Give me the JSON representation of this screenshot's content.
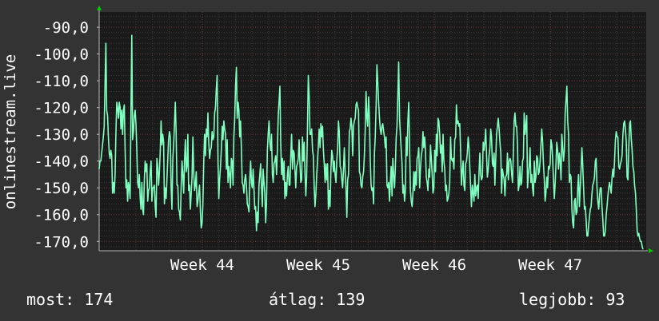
{
  "chart_data": {
    "type": "line",
    "title": "",
    "xlabel": "",
    "ylabel": "onlinestream.live",
    "ylim": [
      -173.5,
      -84.3
    ],
    "y_ticks": [
      "-90,0",
      "-100,0",
      "-110,0",
      "-120,0",
      "-130,0",
      "-140,0",
      "-150,0",
      "-160,0",
      "-170,0"
    ],
    "y_tick_values": [
      -90,
      -100,
      -110,
      -120,
      -130,
      -140,
      -150,
      -160,
      -170
    ],
    "x_ticks": [
      "Week 44",
      "Week 45",
      "Week 46",
      "Week 47"
    ],
    "x_tick_positions": [
      0.1885,
      0.4006,
      0.6126,
      0.8247
    ],
    "grid": true,
    "legend": "none",
    "colors": {
      "background": "#333333",
      "plot": "#1a1a1a",
      "line": "#7fffc0",
      "grid_major": "#6b3a3a",
      "grid_minor": "#3a3a3a",
      "arrow": "#00cc00"
    },
    "series": [
      {
        "values": [
          -143,
          -140,
          -140,
          -137,
          -134,
          -131,
          -127,
          -112,
          -96,
          -121,
          -123,
          -131,
          -137,
          -139,
          -136,
          -138,
          -152,
          -148,
          -152,
          -145,
          -130,
          -118,
          -120,
          -124,
          -118,
          -120,
          -128,
          -121,
          -130,
          -121,
          -119,
          -135,
          -150,
          -147,
          -155,
          -148,
          -150,
          -154,
          -120,
          -93,
          -132,
          -129,
          -123,
          -121,
          -126,
          -136,
          -148,
          -150,
          -145,
          -154,
          -158,
          -148,
          -158,
          -160,
          -147,
          -140,
          -144,
          -141,
          -155,
          -151,
          -150,
          -144,
          -140,
          -155,
          -150,
          -150,
          -149,
          -157,
          -161,
          -139,
          -142,
          -149,
          -144,
          -136,
          -125,
          -134,
          -130,
          -133,
          -156,
          -150,
          -154,
          -147,
          -139,
          -132,
          -129,
          -131,
          -150,
          -158,
          -139,
          -134,
          -126,
          -118,
          -129,
          -149,
          -149,
          -158,
          -159,
          -162,
          -150,
          -140,
          -145,
          -152,
          -140,
          -132,
          -144,
          -142,
          -130,
          -151,
          -149,
          -158,
          -152,
          -146,
          -131,
          -144,
          -151,
          -149,
          -144,
          -157,
          -155,
          -152,
          -149,
          -159,
          -165,
          -163,
          -156,
          -140,
          -130,
          -138,
          -128,
          -131,
          -122,
          -133,
          -139,
          -136,
          -135,
          -129,
          -132,
          -131,
          -122,
          -120,
          -113,
          -108,
          -140,
          -154,
          -147,
          -142,
          -136,
          -127,
          -132,
          -125,
          -128,
          -130,
          -143,
          -132,
          -148,
          -142,
          -145,
          -150,
          -139,
          -140,
          -149,
          -131,
          -124,
          -112,
          -105,
          -124,
          -118,
          -121,
          -131,
          -125,
          -135,
          -148,
          -149,
          -152,
          -147,
          -145,
          -149,
          -156,
          -157,
          -159,
          -147,
          -140,
          -148,
          -150,
          -143,
          -150,
          -158,
          -157,
          -166,
          -159,
          -163,
          -149,
          -145,
          -141,
          -150,
          -157,
          -143,
          -148,
          -152,
          -163,
          -156,
          -136,
          -130,
          -125,
          -133,
          -136,
          -130,
          -145,
          -148,
          -141,
          -140,
          -138,
          -145,
          -136,
          -123,
          -118,
          -112,
          -133,
          -145,
          -139,
          -147,
          -140,
          -154,
          -148,
          -153,
          -145,
          -142,
          -149,
          -149,
          -138,
          -130,
          -143,
          -136,
          -137,
          -143,
          -150,
          -142,
          -141,
          -139,
          -132,
          -141,
          -148,
          -147,
          -131,
          -140,
          -133,
          -145,
          -153,
          -146,
          -127,
          -108,
          -116,
          -130,
          -130,
          -128,
          -136,
          -138,
          -150,
          -157,
          -152,
          -145,
          -140,
          -134,
          -128,
          -135,
          -126,
          -131,
          -127,
          -136,
          -141,
          -148,
          -141,
          -147,
          -141,
          -158,
          -151,
          -157,
          -143,
          -136,
          -138,
          -144,
          -140,
          -145,
          -148,
          -140,
          -135,
          -125,
          -129,
          -142,
          -143,
          -147,
          -150,
          -143,
          -135,
          -144,
          -150,
          -161,
          -147,
          -145,
          -129,
          -128,
          -124,
          -127,
          -138,
          -127,
          -125,
          -124,
          -119,
          -118,
          -120,
          -121,
          -144,
          -145,
          -149,
          -150,
          -146,
          -144,
          -138,
          -128,
          -114,
          -124,
          -127,
          -116,
          -124,
          -140,
          -149,
          -151,
          -150,
          -156,
          -137,
          -131,
          -119,
          -104,
          -111,
          -118,
          -124,
          -128,
          -130,
          -127,
          -126,
          -129,
          -131,
          -135,
          -131,
          -149,
          -150,
          -148,
          -155,
          -148,
          -142,
          -153,
          -139,
          -145,
          -150,
          -143,
          -131,
          -127,
          -115,
          -103,
          -124,
          -130,
          -136,
          -141,
          -152,
          -149,
          -155,
          -151,
          -131,
          -138,
          -125,
          -118,
          -134,
          -151,
          -155,
          -157,
          -152,
          -144,
          -151,
          -144,
          -149,
          -139,
          -138,
          -135,
          -150,
          -143,
          -138,
          -136,
          -129,
          -135,
          -131,
          -136,
          -146,
          -148,
          -151,
          -143,
          -146,
          -134,
          -139,
          -145,
          -152,
          -150,
          -136,
          -144,
          -130,
          -138,
          -124,
          -125,
          -130,
          -137,
          -134,
          -144,
          -130,
          -140,
          -143,
          -151,
          -149,
          -155,
          -154,
          -152,
          -148,
          -131,
          -139,
          -140,
          -139,
          -143,
          -132,
          -131,
          -119,
          -126,
          -125,
          -127,
          -126,
          -136,
          -149,
          -144,
          -140,
          -149,
          -151,
          -141,
          -140,
          -137,
          -131,
          -135,
          -142,
          -150,
          -157,
          -149,
          -152,
          -155,
          -145,
          -153,
          -150,
          -149,
          -154,
          -144,
          -137,
          -145,
          -147,
          -146,
          -133,
          -136,
          -133,
          -128,
          -138,
          -146,
          -143,
          -138,
          -135,
          -128,
          -131,
          -141,
          -142,
          -137,
          -149,
          -139,
          -130,
          -127,
          -124,
          -128,
          -133,
          -137,
          -152,
          -143,
          -145,
          -147,
          -153,
          -146,
          -145,
          -137,
          -147,
          -140,
          -139,
          -140,
          -145,
          -148,
          -138,
          -125,
          -122,
          -127,
          -127,
          -134,
          -151,
          -149,
          -142,
          -149,
          -148,
          -140,
          -139,
          -122,
          -130,
          -127,
          -123,
          -150,
          -145,
          -142,
          -135,
          -148,
          -145,
          -150,
          -153,
          -140,
          -148,
          -146,
          -138,
          -139,
          -145,
          -144,
          -140,
          -134,
          -128,
          -133,
          -141,
          -147,
          -155,
          -152,
          -146,
          -150,
          -142,
          -143,
          -141,
          -132,
          -134,
          -139,
          -147,
          -154,
          -148,
          -141,
          -133,
          -136,
          -143,
          -137,
          -140,
          -147,
          -130,
          -135,
          -140,
          -136,
          -122,
          -117,
          -112,
          -125,
          -130,
          -148,
          -145,
          -146,
          -158,
          -163,
          -165,
          -155,
          -154,
          -160,
          -159,
          -150,
          -145,
          -157,
          -150,
          -143,
          -135,
          -142,
          -150,
          -158,
          -157,
          -162,
          -168,
          -168,
          -164,
          -161,
          -158,
          -157,
          -152,
          -149,
          -148,
          -146,
          -140,
          -139,
          -150,
          -155,
          -158,
          -153,
          -150,
          -150,
          -157,
          -162,
          -168,
          -168,
          -166,
          -160,
          -157,
          -153,
          -150,
          -148,
          -150,
          -152,
          -146,
          -143,
          -146,
          -140,
          -132,
          -129,
          -131,
          -131,
          -142,
          -143,
          -141,
          -140,
          -138,
          -130,
          -126,
          -125,
          -128,
          -133,
          -146,
          -147,
          -135,
          -126,
          -125,
          -132,
          -136,
          -142,
          -144,
          -149,
          -152,
          -158,
          -166,
          -168,
          -167,
          -169,
          -170,
          -170,
          -172,
          -173
        ]
      }
    ]
  },
  "stats": {
    "current_label": "most:",
    "current_value": "174",
    "average_label": "átlag:",
    "average_value": "139",
    "best_label": "legjobb:",
    "best_value": "93"
  }
}
